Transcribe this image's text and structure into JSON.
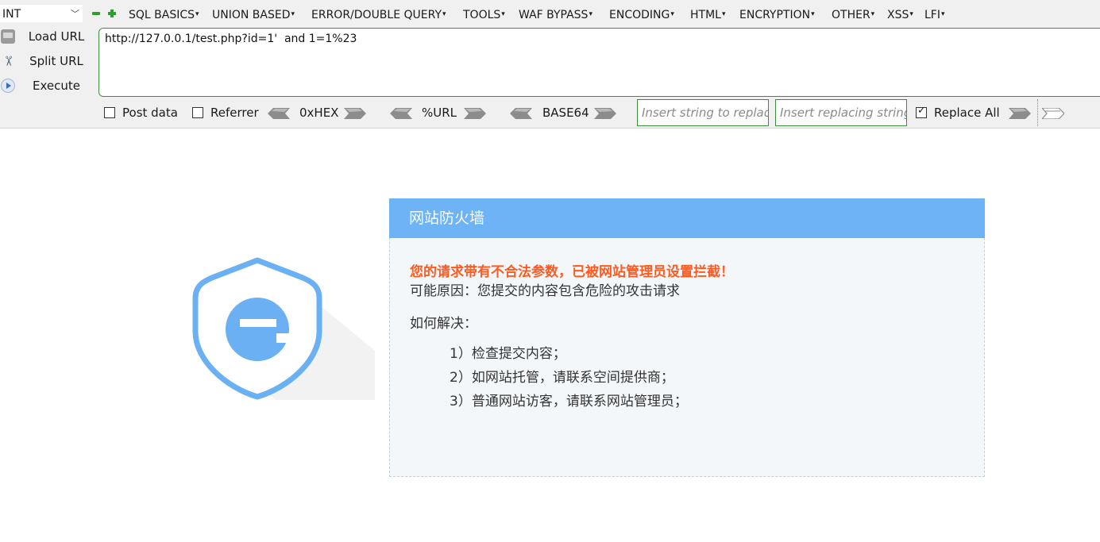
{
  "toolbar": {
    "select_value": "INT",
    "menus": [
      "SQL BASICS",
      "UNION BASED",
      "ERROR/DOUBLE QUERY",
      "TOOLS",
      "WAF BYPASS",
      "ENCODING",
      "HTML",
      "ENCRYPTION",
      "OTHER",
      "XSS",
      "LFI"
    ],
    "side": {
      "load": "Load URL",
      "split": "Split URL",
      "execute": "Execute"
    },
    "url": "http://127.0.0.1/test.php?id=1'  and 1=1%23",
    "options": {
      "post_data": "Post data",
      "post_data_checked": false,
      "referrer": "Referrer",
      "referrer_checked": false,
      "hex": "0xHEX",
      "url_enc": "%URL",
      "base64": "BASE64",
      "replace_placeholder": "Insert string to replace",
      "replacing_placeholder": "Insert replacing string",
      "replace_all": "Replace All",
      "replace_all_checked": true
    }
  },
  "waf": {
    "title": "网站防火墙",
    "warning": "您的请求带有不合法参数，已被网站管理员设置拦截！",
    "reason": "可能原因：您提交的内容包含危险的攻击请求",
    "howto": "如何解决：",
    "steps": [
      "1）检查提交内容；",
      "2）如网站托管，请联系空间提供商；",
      "3）普通网站访客，请联系网站管理员；"
    ]
  },
  "colors": {
    "accent_green": "#3c8f3c",
    "header_blue": "#6db3f5",
    "warning_orange": "#ff5a1f",
    "logo_blue": "#6ab0f3"
  }
}
